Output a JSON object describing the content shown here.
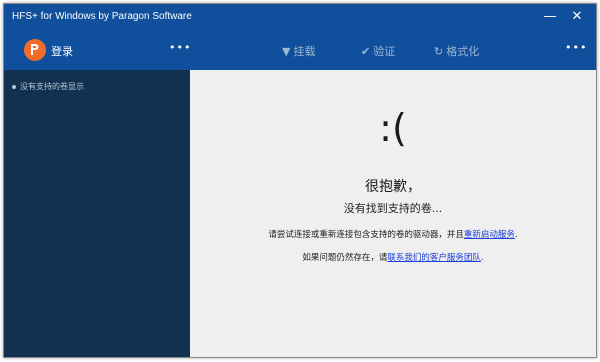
{
  "window": {
    "title": "HFS+ for Windows by Paragon Software",
    "minimize_glyph": "—",
    "close_glyph": "✕"
  },
  "toolbar": {
    "login_label": "登录",
    "menu_dots": "•••",
    "mount_icon": "▼",
    "mount_label": "挂载",
    "verify_icon": "✔",
    "verify_label": "验证",
    "format_icon": "↻",
    "format_label": "格式化",
    "right_dots": "•••"
  },
  "sidebar": {
    "item_label": "没有支持的卷显示"
  },
  "main": {
    "face": ":(",
    "sorry": "很抱歉，",
    "no_volume": "没有找到支持的卷...",
    "line1_text": "请尝试连接或重新连接包含支持的卷的驱动器，并且",
    "line1_link": "重新启动服务",
    "line1_end": ".",
    "line2_text": "如果问题仍然存在，请",
    "line2_link": "联系我们的客户服务团队",
    "line2_end": "."
  },
  "colors": {
    "header_blue": "#0f4f9c",
    "sidebar_navy": "#12304f",
    "logo_orange": "#f26b2a",
    "link_blue": "#1a3ed8"
  }
}
